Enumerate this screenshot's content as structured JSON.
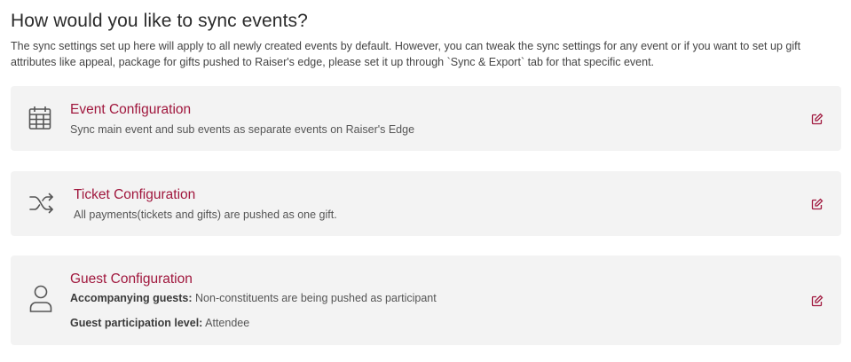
{
  "page": {
    "heading": "How would you like to sync events?",
    "intro": "The sync settings set up here will apply to all newly created events by default. However, you can tweak the sync settings for any event or if you want to set up gift attributes like appeal, package for gifts pushed to Raiser's edge, please set it up through `Sync & Export` tab for that specific event."
  },
  "cards": {
    "event": {
      "icon": "calendar-icon",
      "title": "Event Configuration",
      "description": "Sync main event and sub events as separate events on Raiser's Edge"
    },
    "ticket": {
      "icon": "shuffle-icon",
      "title": "Ticket Configuration",
      "description": "All payments(tickets and gifts) are pushed as one gift."
    },
    "guest": {
      "icon": "user-icon",
      "title": "Guest Configuration",
      "accompanying_label": "Accompanying guests:",
      "accompanying_value": "Non-constituents are being pushed as participant",
      "participation_label": "Guest participation level:",
      "participation_value": "Attendee"
    }
  },
  "colors": {
    "accent": "#a0173d",
    "card_bg": "#f3f3f3"
  }
}
